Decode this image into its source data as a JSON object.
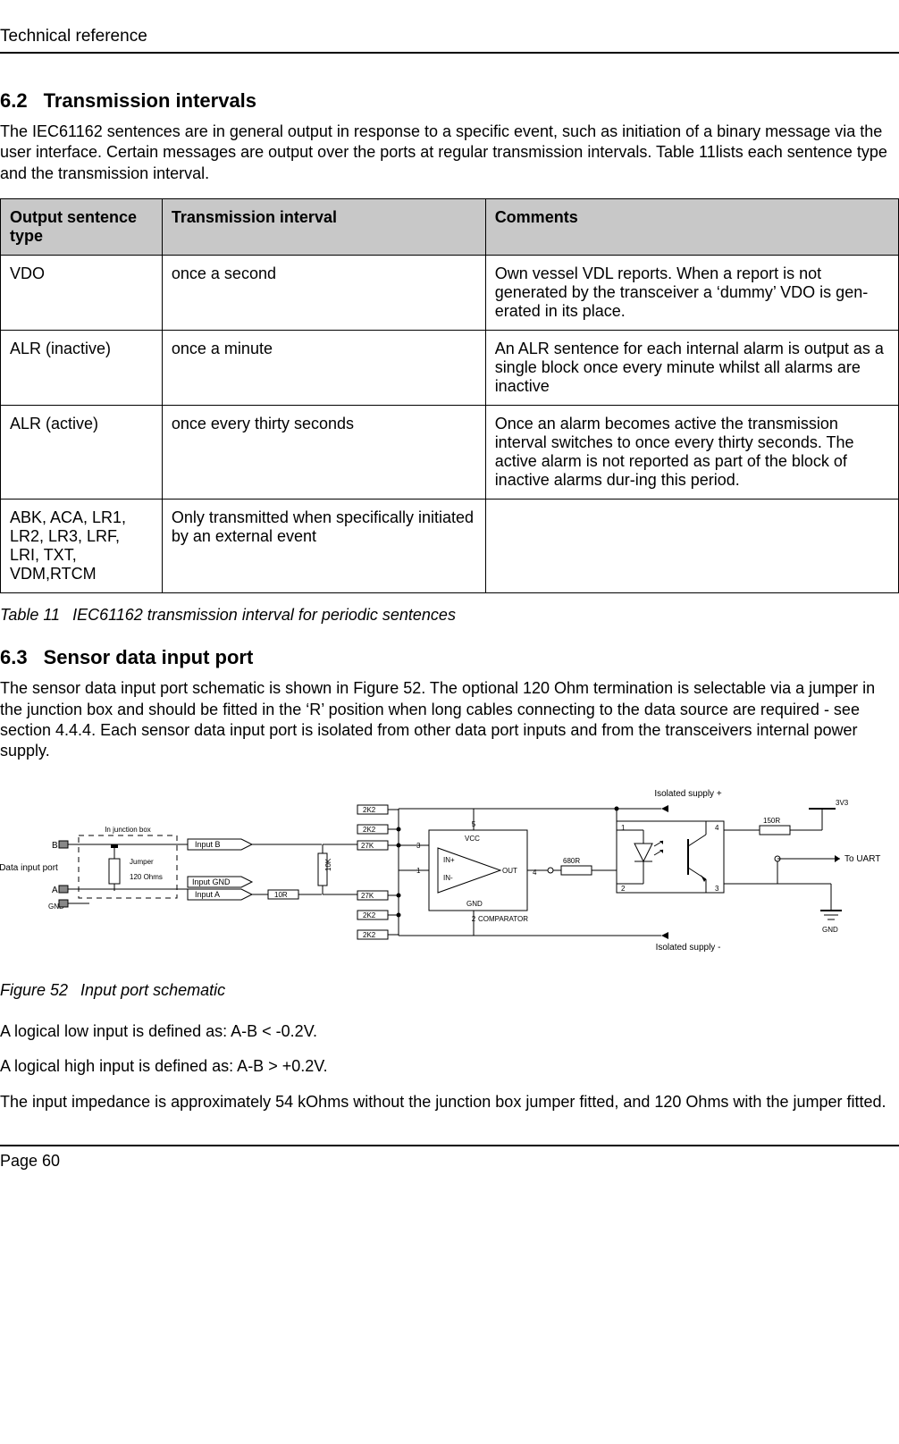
{
  "header": "Technical reference",
  "section62": {
    "number": "6.2",
    "title": "Transmission intervals",
    "intro": "The IEC61162 sentences are in general output in response to a specific event, such as initiation of a binary message via the user interface. Certain messages are output over the ports at regular transmission intervals. Table 11lists each sentence type and the transmission interval."
  },
  "table11": {
    "headers": {
      "col1": "Output sentence type",
      "col2": "Transmission interval",
      "col3": "Comments"
    },
    "rows": [
      {
        "c1": "VDO",
        "c2": "once a second",
        "c3": "Own vessel VDL reports. When a report is not generated by the transceiver a ‘dummy’ VDO is gen-erated in its place."
      },
      {
        "c1": "ALR (inactive)",
        "c2": "once a minute",
        "c3": "An ALR sentence for each internal alarm is output as a single block once every minute whilst all alarms are inactive"
      },
      {
        "c1": "ALR (active)",
        "c2": "once every thirty seconds",
        "c3": "Once an alarm becomes active the transmission interval switches to once every thirty seconds. The active alarm is not reported as part of the block of inactive alarms dur-ing this period."
      },
      {
        "c1": "ABK, ACA, LR1, LR2, LR3, LRF, LRI, TXT, VDM,RTCM",
        "c2": "Only transmitted when specifically initiated by an external event",
        "c3": ""
      }
    ],
    "caption_label": "Table 11",
    "caption_text": "IEC61162 transmission interval for periodic sentences"
  },
  "section63": {
    "number": "6.3",
    "title": "Sensor data input port",
    "intro": "The sensor data input port schematic is shown in Figure 52. The optional 120 Ohm termination is selectable via a jumper in the junction box and should be fitted in the ‘R’ position when long cables connecting to the data source are required - see section 4.4.4. Each sensor data input port is isolated from other data port inputs and from the transceivers internal power supply."
  },
  "figure52": {
    "caption_label": "Figure 52",
    "caption_text": "Input port schematic",
    "labels": {
      "data_input_port": "Data input port",
      "b": "B",
      "a": "A",
      "gnd_left": "GND",
      "in_junction_box": "In junction box",
      "jumper": "Jumper",
      "ohms120": "120 Ohms",
      "input_b": "Input B",
      "input_gnd": "Input GND",
      "input_a": "Input A",
      "isolated_plus": "Isolated supply +",
      "isolated_minus": "Isolated supply -",
      "r2k2a": "2K2",
      "r2k2b": "2K2",
      "r2k2c": "2K2",
      "r2k2d": "2K2",
      "r27ka": "27K",
      "r27kb": "27K",
      "r10r": "10R",
      "r10k": "10K",
      "r680": "680R",
      "r150": "150R",
      "vcc": "VCC",
      "in_plus": "IN+",
      "in_minus": "IN-",
      "out": "OUT",
      "gnd_comp": "GND",
      "comparator": "COMPARATOR",
      "pin1": "1",
      "pin2": "2",
      "pin3": "3",
      "pin4": "4",
      "pin5": "5",
      "opto1": "1",
      "opto2": "2",
      "opto3": "3",
      "opto4": "4",
      "v3v3": "3V3",
      "to_uart": "To UART",
      "gnd_right": "GND"
    }
  },
  "after_figure": {
    "line1": "A logical low input is defined as: A-B < -0.2V.",
    "line2": "A logical high input is defined as: A-B > +0.2V.",
    "line3": "The input impedance is approximately 54 kOhms without the junction box jumper fitted, and 120 Ohms with the jumper fitted."
  },
  "footer": "Page 60"
}
